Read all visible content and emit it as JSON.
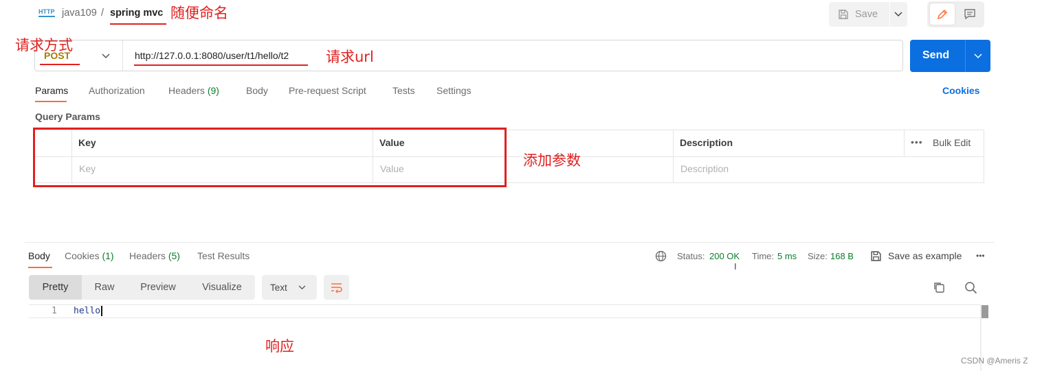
{
  "header": {
    "method_badge": "HTTP",
    "collection": "java109",
    "separator": "/",
    "request_name": "spring mvc",
    "save_label": "Save"
  },
  "request": {
    "method": "POST",
    "url": "http://127.0.0.1:8080/user/t1/hello/t2",
    "send_label": "Send"
  },
  "request_tabs": [
    {
      "label": "Params"
    },
    {
      "label": "Authorization"
    },
    {
      "label": "Headers",
      "count": "(9)"
    },
    {
      "label": "Body"
    },
    {
      "label": "Pre-request Script"
    },
    {
      "label": "Tests"
    },
    {
      "label": "Settings"
    }
  ],
  "cookies_link": "Cookies",
  "query_params": {
    "title": "Query Params",
    "columns": {
      "key": "Key",
      "value": "Value",
      "description": "Description"
    },
    "bulk_edit": "Bulk Edit",
    "placeholders": {
      "key": "Key",
      "value": "Value",
      "description": "Description"
    }
  },
  "response": {
    "tabs": [
      {
        "label": "Body"
      },
      {
        "label": "Cookies",
        "count": "(1)"
      },
      {
        "label": "Headers",
        "count": "(5)"
      },
      {
        "label": "Test Results"
      }
    ],
    "status_label": "Status:",
    "status_value": "200 OK",
    "time_label": "Time:",
    "time_value": "5 ms",
    "size_label": "Size:",
    "size_value": "168 B",
    "save_example": "Save as example",
    "views": [
      "Pretty",
      "Raw",
      "Preview",
      "Visualize"
    ],
    "format": "Text",
    "lines": [
      {
        "num": "1",
        "text": "hello"
      }
    ]
  },
  "annotations": {
    "naming": "随便命名",
    "method": "请求方式",
    "url": "请求url",
    "params": "添加参数",
    "response": "响应"
  },
  "watermark": "CSDN @Ameris Z",
  "colors": {
    "accent": "#0c6fe0",
    "orange": "#ff6c37",
    "annotation": "#e0201f",
    "status_ok": "#0a7d2c"
  }
}
